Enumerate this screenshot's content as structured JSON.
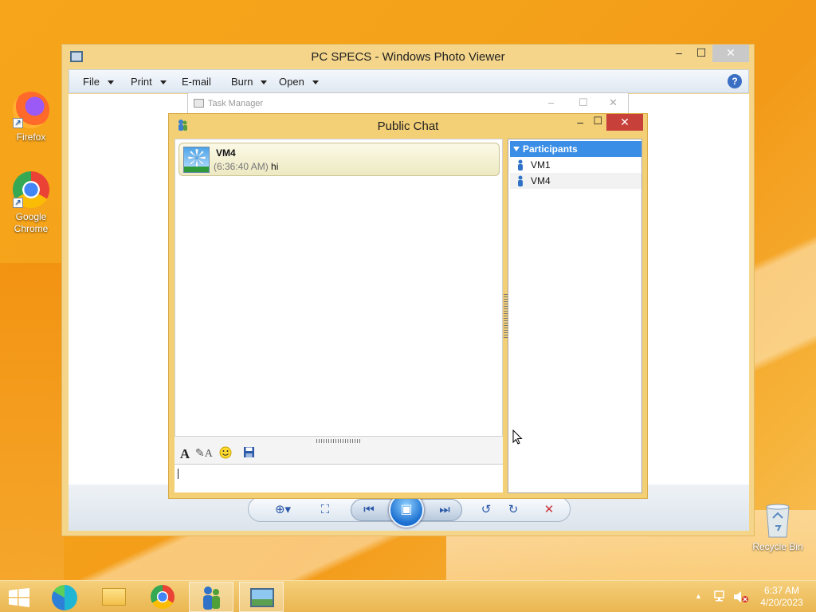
{
  "desktop": {
    "icons": [
      {
        "label": "Firefox",
        "icon": "firefox-icon"
      },
      {
        "label": "Google Chrome",
        "icon": "chrome-icon"
      }
    ],
    "recycle_bin": "Recycle Bin"
  },
  "photo_viewer": {
    "title": "PC SPECS - Windows Photo Viewer",
    "menu": [
      "File",
      "Print",
      "E-mail",
      "Burn",
      "Open"
    ],
    "help": "?"
  },
  "task_manager": {
    "title": "Task Manager"
  },
  "chat": {
    "title": "Public Chat",
    "messages": [
      {
        "sender": "VM4",
        "time": "(6:36:40 AM)",
        "text": "hi"
      }
    ],
    "participants_header": "Participants",
    "participants": [
      "VM1",
      "VM4"
    ],
    "input_value": ""
  },
  "taskbar": {
    "apps": [
      "start-icon",
      "edge-icon",
      "file-explorer-icon",
      "chrome-icon",
      "chat-app-icon",
      "photo-viewer-icon"
    ],
    "active": "chat-app-icon",
    "clock_time": "6:37 AM",
    "clock_date": "4/20/2023"
  },
  "colors": {
    "desktop_accent": "#f4a21a",
    "chat_frame": "#f3cf76",
    "participants_header": "#3a8ee6",
    "close_button": "#c7403a"
  }
}
